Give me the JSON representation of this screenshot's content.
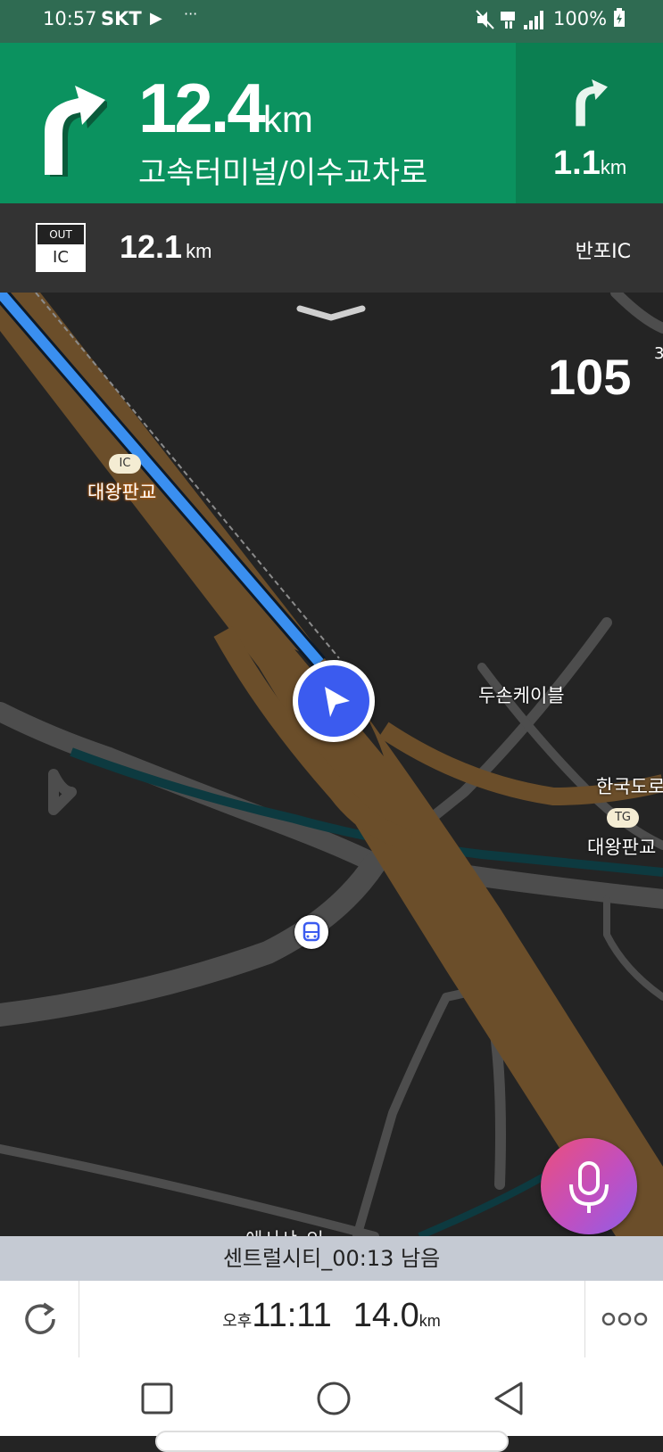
{
  "status_bar": {
    "time": "10:57",
    "carrier": "SKT",
    "battery": "100%"
  },
  "turn": {
    "distance": "12.4",
    "unit": "km",
    "road_name": "고속터미널/이수교차로"
  },
  "next_turn": {
    "distance": "1.1",
    "unit": "km"
  },
  "exit": {
    "badge_top": "OUT",
    "badge_bottom": "IC",
    "distance": "12.1",
    "unit": "km",
    "name": "반포IC"
  },
  "map": {
    "speed": "105",
    "speed_fragment": "3",
    "ic_pill": "IC",
    "ic_name": "대왕판교",
    "poi_doosan": "두손케이블",
    "poi_korea": "한국도로",
    "tg_pill": "TG",
    "tg_name": "대왕판교",
    "partial_label": "에서샤_인"
  },
  "destination_banner": "센트럴시티_00:13 남음",
  "arrival": {
    "ampm": "오후",
    "time": "11:11",
    "remaining": "14.0",
    "unit": "km"
  },
  "icons": {
    "turn": "turn-right-arrow-icon",
    "next_turn": "turn-right-arrow-icon",
    "current_position": "navigation-arrow-icon",
    "bus": "bus-stop-icon",
    "mic": "microphone-icon",
    "reroute": "refresh-icon",
    "more": "more-dots-icon"
  },
  "colors": {
    "turn_banner": "#0b925f",
    "next_turn_banner": "#0b7f51",
    "route": "#3a8ff0",
    "highway": "#6b4e2a",
    "position_marker": "#3b5bef"
  }
}
